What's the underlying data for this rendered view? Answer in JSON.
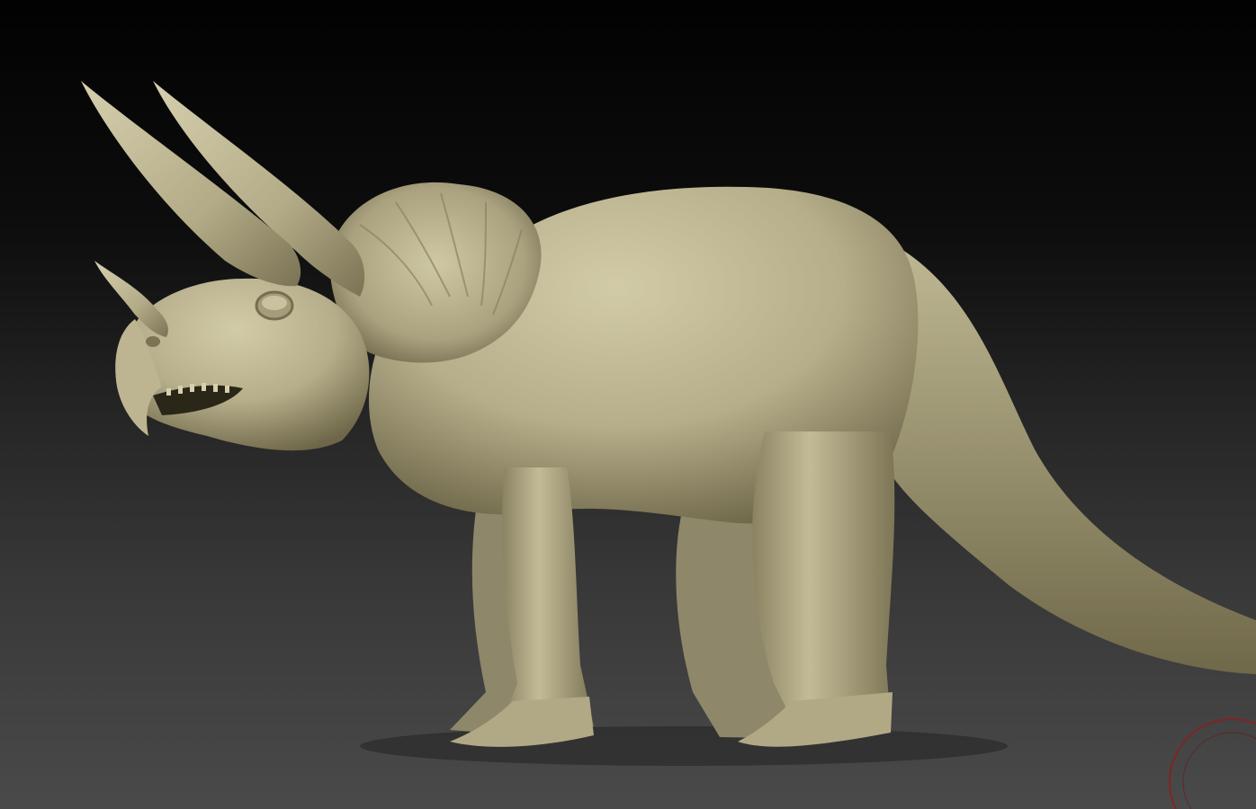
{
  "scene": {
    "subject": "triceratops-sculpt",
    "colors": {
      "background_top": "#020202",
      "background_bottom": "#4a4a4a",
      "model_base": "#b6ae8a",
      "model_highlight": "#d2cba7",
      "model_shadow": "#6d6648",
      "gizmo_ring": "#8a2020"
    }
  }
}
